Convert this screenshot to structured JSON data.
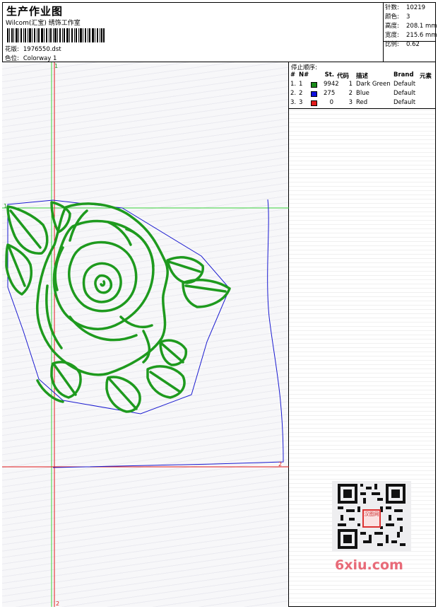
{
  "header": {
    "title": "生产作业图",
    "studio": "Wilcom(汇宝) 绣饰工作室",
    "design_label": "花版:",
    "design_value": "1976550.dst",
    "colorway_label": "色位:",
    "colorway_value": "Colorway 1"
  },
  "stats": [
    {
      "label": "针数:",
      "value": "10219"
    },
    {
      "label": "颜色:",
      "value": "3"
    },
    {
      "label": "高度:",
      "value": "208.1 mm"
    },
    {
      "label": "宽度:",
      "value": "215.6 mm"
    },
    {
      "label": "比例:",
      "value": "0.62"
    }
  ],
  "stop_sequence": {
    "title": "停止顺序:",
    "columns": [
      "#",
      "N#",
      "St.",
      "代码",
      "描述",
      "Brand",
      "元素"
    ],
    "rows": [
      {
        "idx": "1.",
        "n": "1",
        "stitches": "9942",
        "code": "1",
        "desc": "Dark Green",
        "brand": "Default",
        "swatch": "#1a8a1a"
      },
      {
        "idx": "2.",
        "n": "2",
        "stitches": "275",
        "code": "2",
        "desc": "Blue",
        "brand": "Default",
        "swatch": "#1010dd"
      },
      {
        "idx": "3.",
        "n": "3",
        "stitches": "0",
        "code": "3",
        "desc": "Red",
        "brand": "Default",
        "swatch": "#e01a1a"
      }
    ]
  },
  "markers": {
    "start_top": "1",
    "start_left": "1",
    "end_right": "2",
    "end_bottom": "2"
  },
  "watermark": {
    "brand": "6xiu.com",
    "stamp": "汉图网"
  },
  "colors": {
    "green_thread": "#1e9a1e",
    "blue_thread": "#1a1ad0",
    "red_axis": "#e01a1a",
    "guide_green": "#3ad13a"
  }
}
